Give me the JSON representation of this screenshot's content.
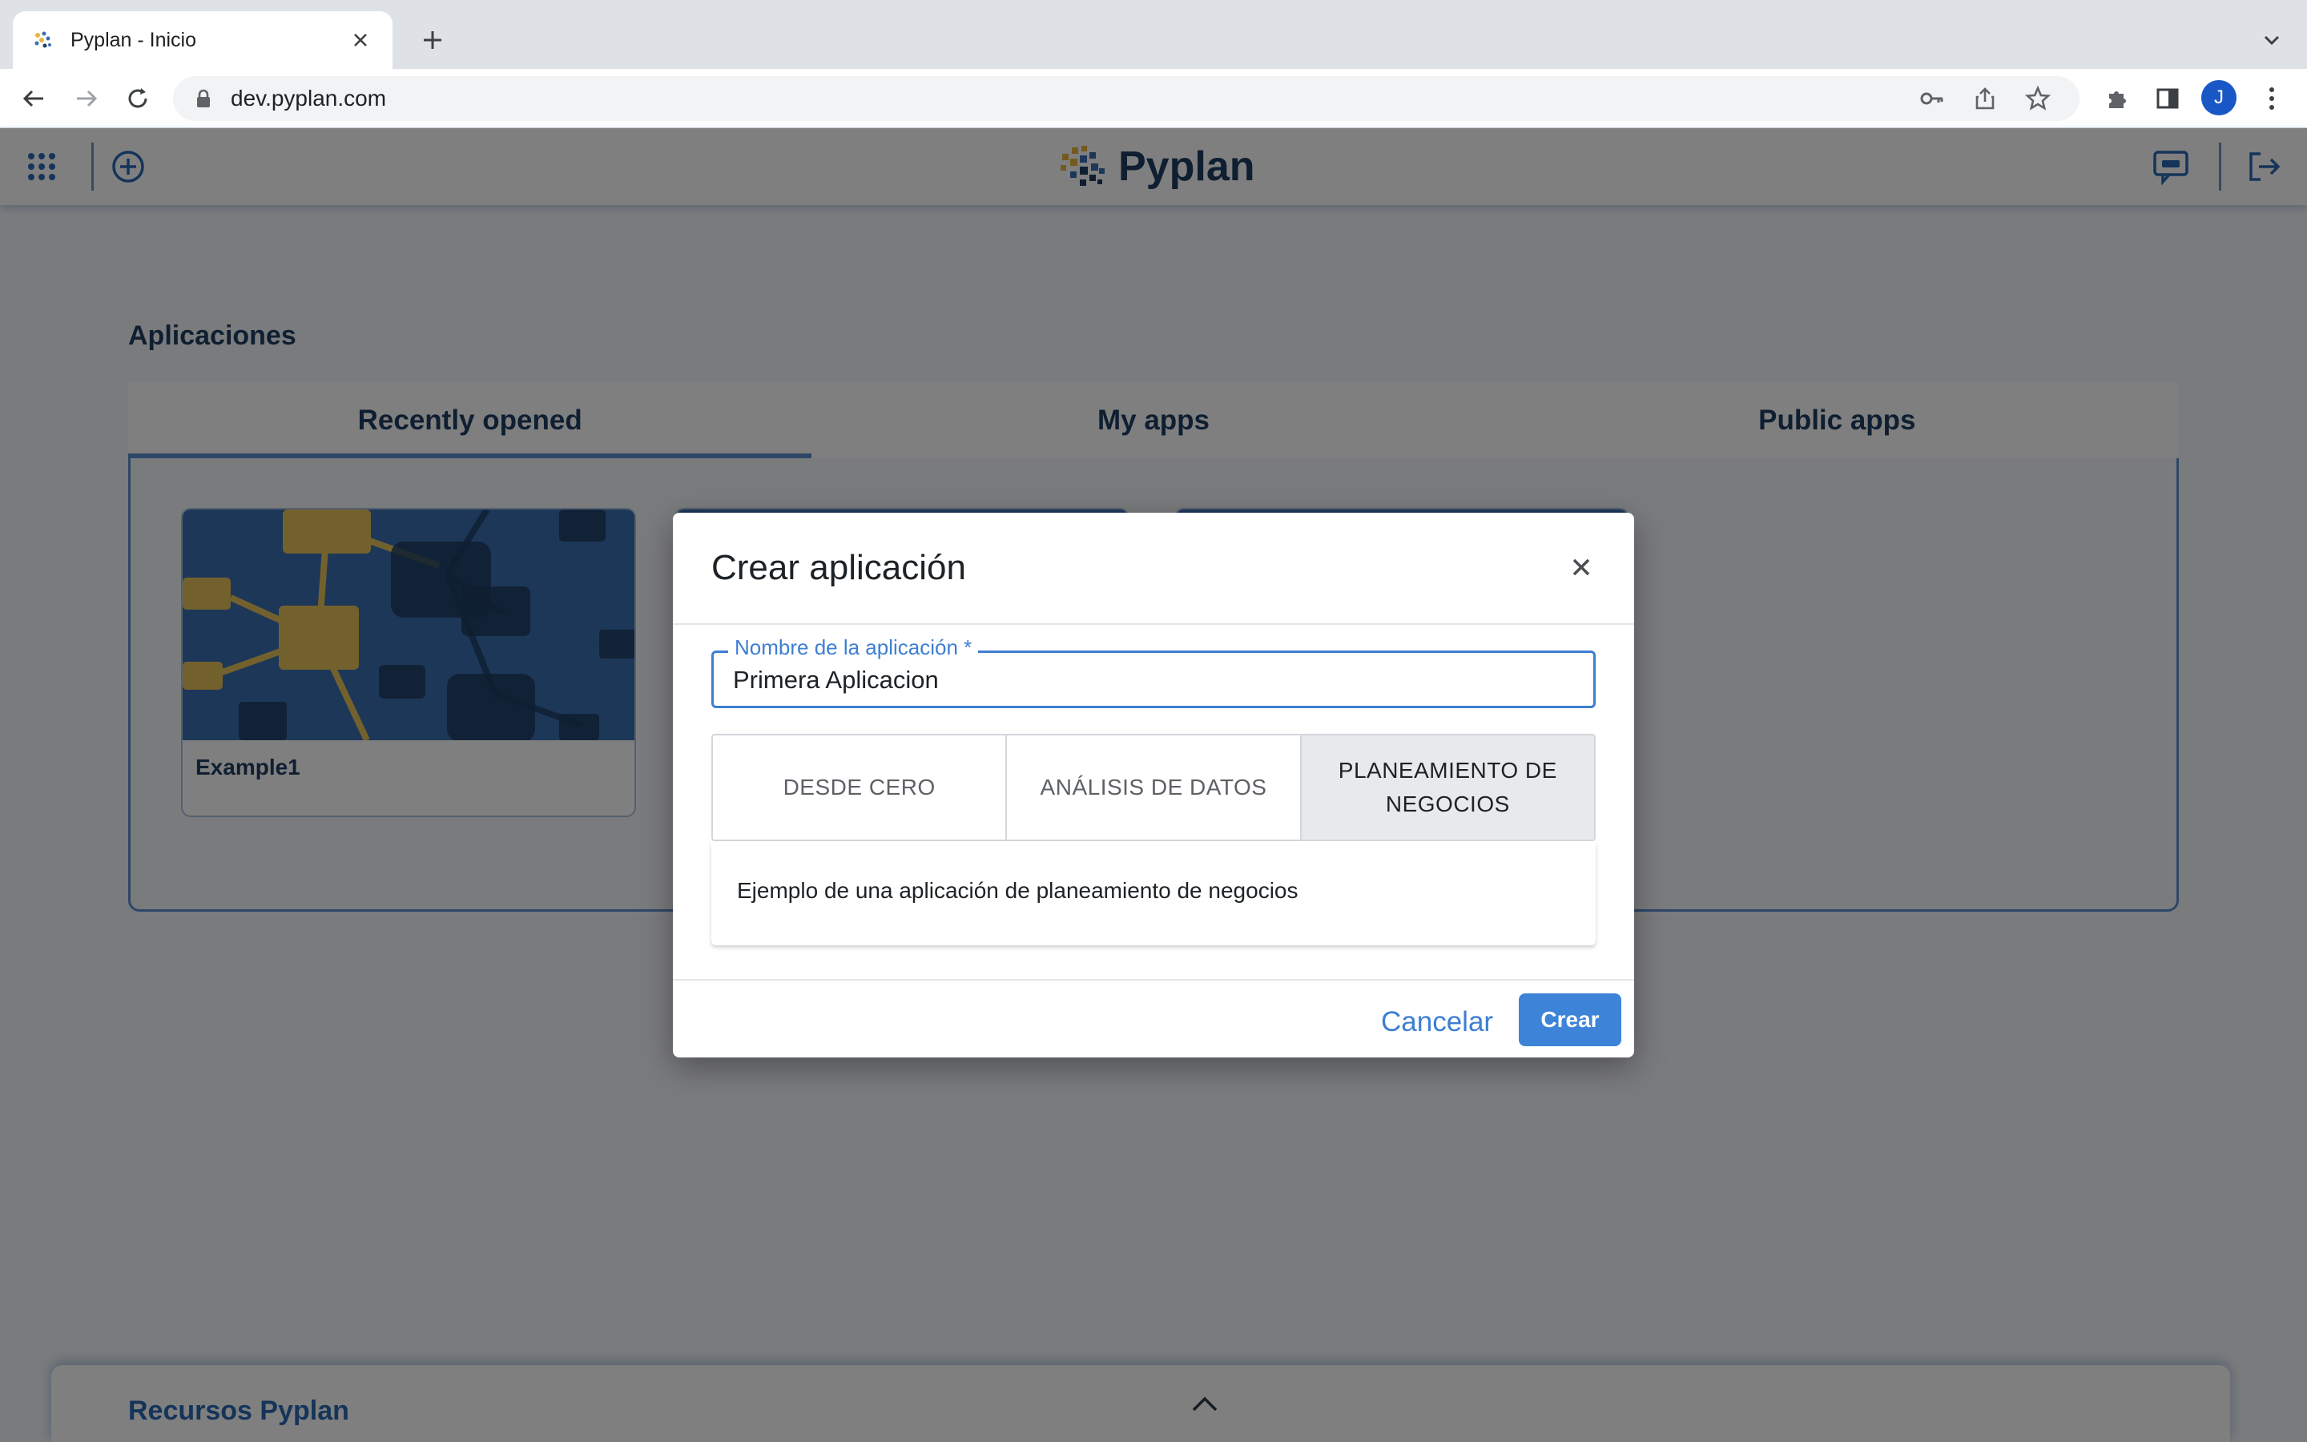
{
  "browser": {
    "tab_title": "Pyplan - Inicio",
    "url": "dev.pyplan.com",
    "profile_initial": "J"
  },
  "app": {
    "brand": "Pyplan",
    "section_title": "Aplicaciones",
    "tabs": [
      {
        "label": "Recently opened",
        "active": true
      },
      {
        "label": "My apps",
        "active": false
      },
      {
        "label": "Public apps",
        "active": false
      }
    ],
    "cards": [
      {
        "label": "Example1"
      }
    ],
    "resources_title": "Recursos Pyplan"
  },
  "dialog": {
    "title": "Crear aplicación",
    "field_label": "Nombre de la aplicación *",
    "field_value": "Primera Aplicacion",
    "options": [
      {
        "label": "DESDE CERO",
        "selected": false
      },
      {
        "label": "ANÁLISIS DE DATOS",
        "selected": false
      },
      {
        "label": "PLANEAMIENTO DE NEGOCIOS",
        "selected": true
      }
    ],
    "description": "Ejemplo de una aplicación de planeamiento de negocios",
    "cancel_label": "Cancelar",
    "create_label": "Crear"
  },
  "colors": {
    "brand_dark": "#1e3e63",
    "accent": "#3d84d8",
    "panel_border": "#5c8fd0"
  }
}
